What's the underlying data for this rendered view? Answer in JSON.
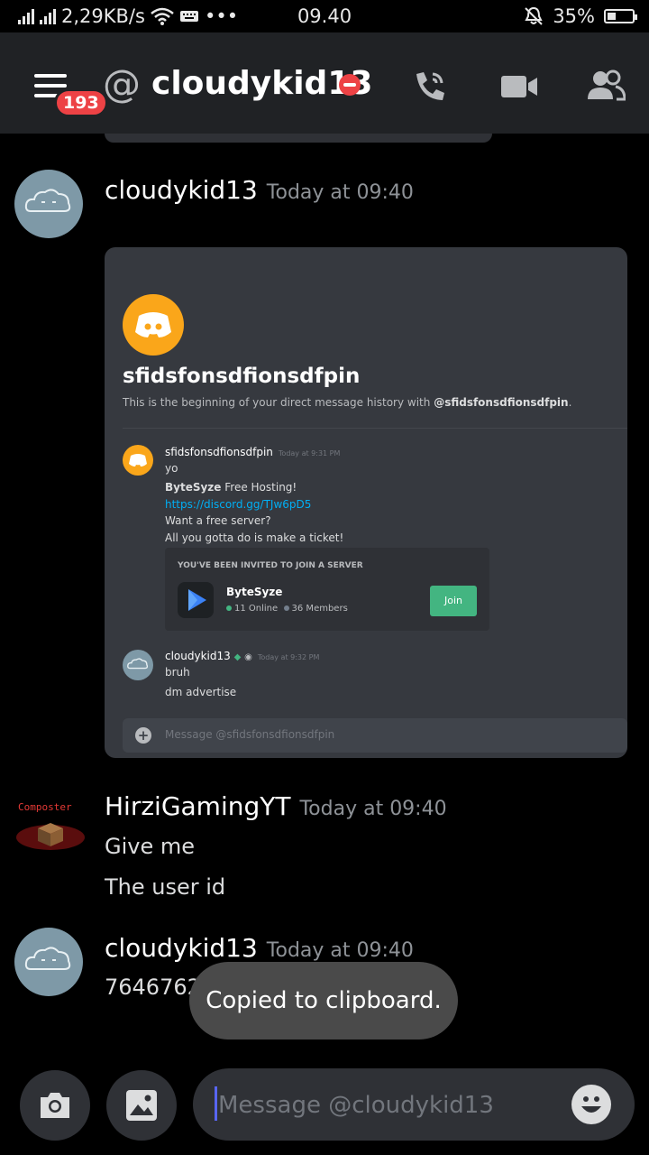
{
  "status_bar": {
    "net_speed": "2,29KB/s",
    "dots": "•••",
    "time": "09.40",
    "battery": "35%",
    "battery_level": 0.35
  },
  "header": {
    "title": "cloudykid13",
    "badge_count": "193",
    "at_symbol": "@"
  },
  "messages": [
    {
      "author": "cloudykid13",
      "timestamp": "Today at 09:40",
      "embed": {
        "dm_title": "sfidsfonsdfionsdfpin",
        "dm_subtitle_prefix": "This is the beginning of your direct message history with ",
        "dm_subtitle_mention": "@sfidsfonsdfionsdfpin",
        "dm_subtitle_suffix": ".",
        "msg1": {
          "author": "sfidsfonsdfionsdfpin",
          "timestamp": "Today at 9:31 PM",
          "lines": {
            "l1": "yo",
            "l2_bold": "ByteSyze",
            "l2_rest": " Free Hosting!",
            "link": "https://discord.gg/TJw6pD5",
            "l4": "Want a free server?",
            "l5": "All you gotta do is make a ticket!"
          }
        },
        "invite": {
          "header": "YOU'VE BEEN INVITED TO JOIN A SERVER",
          "server_name": "ByteSyze",
          "online": "11 Online",
          "members": "36 Members",
          "join_label": "Join"
        },
        "msg2": {
          "author": "cloudykid13",
          "timestamp": "Today at 9:32 PM",
          "l1": "bruh",
          "l2": "dm advertise"
        },
        "input_placeholder": "Message @sfidsfonsdfionsdfpin"
      }
    },
    {
      "author": "HirziGamingYT",
      "timestamp": "Today at 09:40",
      "avatar_label": "Composter",
      "lines": {
        "l1": "Give me",
        "l2": "The user id"
      }
    },
    {
      "author": "cloudykid13",
      "timestamp": "Today at 09:40",
      "text": "7646762"
    }
  ],
  "toast": "Copied to clipboard.",
  "composer": {
    "placeholder": "Message @cloudykid13"
  },
  "colors": {
    "background": "#000000",
    "header": "#202225",
    "accent": "#5865f2",
    "badge": "#ed4245",
    "join": "#43b581"
  }
}
